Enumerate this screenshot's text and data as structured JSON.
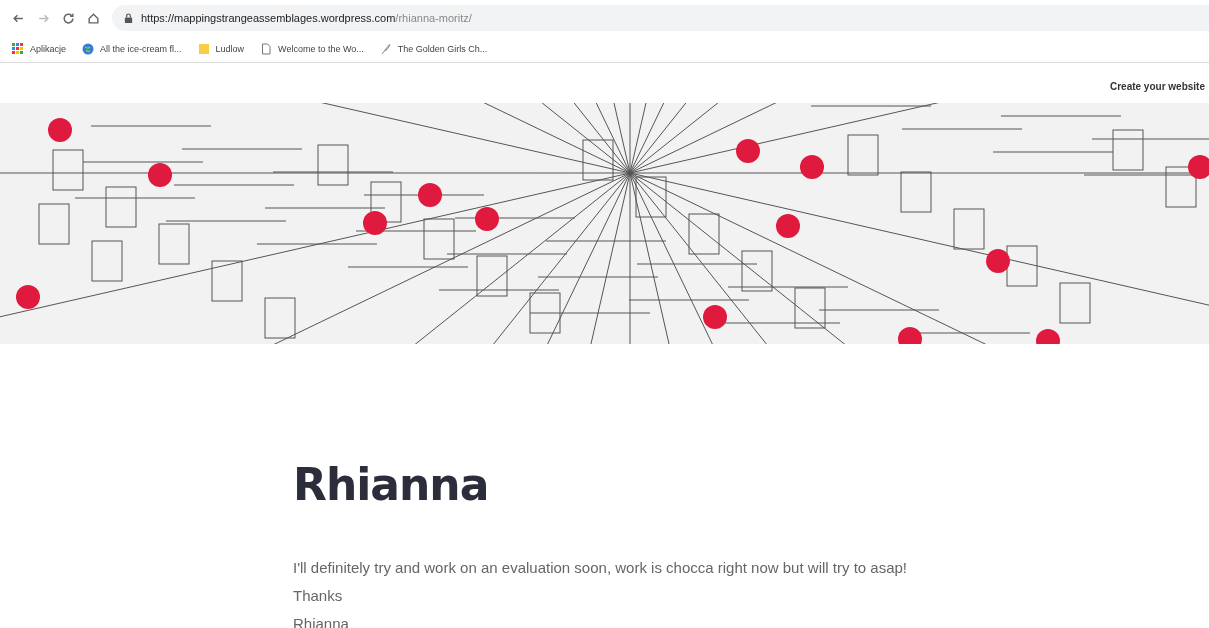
{
  "browser": {
    "url_host": "https://mappingstrangeassemblages.wordpress.com",
    "url_path": "/rhianna-moritz/",
    "bookmarks": [
      {
        "kind": "apps",
        "label": "Aplikacje"
      },
      {
        "kind": "globe",
        "label": "All the ice-cream fl..."
      },
      {
        "kind": "folder",
        "label": "Ludlow"
      },
      {
        "kind": "page",
        "label": "Welcome to the Wo..."
      },
      {
        "kind": "feather",
        "label": "The Golden Girls Ch..."
      }
    ]
  },
  "top_bar": {
    "link": "Create your website"
  },
  "post": {
    "title": "Rhianna",
    "lines": [
      "I'll definitely try and work on an evaluation soon, work is chocca right now but will try to asap!",
      "Thanks",
      "Rhianna"
    ]
  }
}
